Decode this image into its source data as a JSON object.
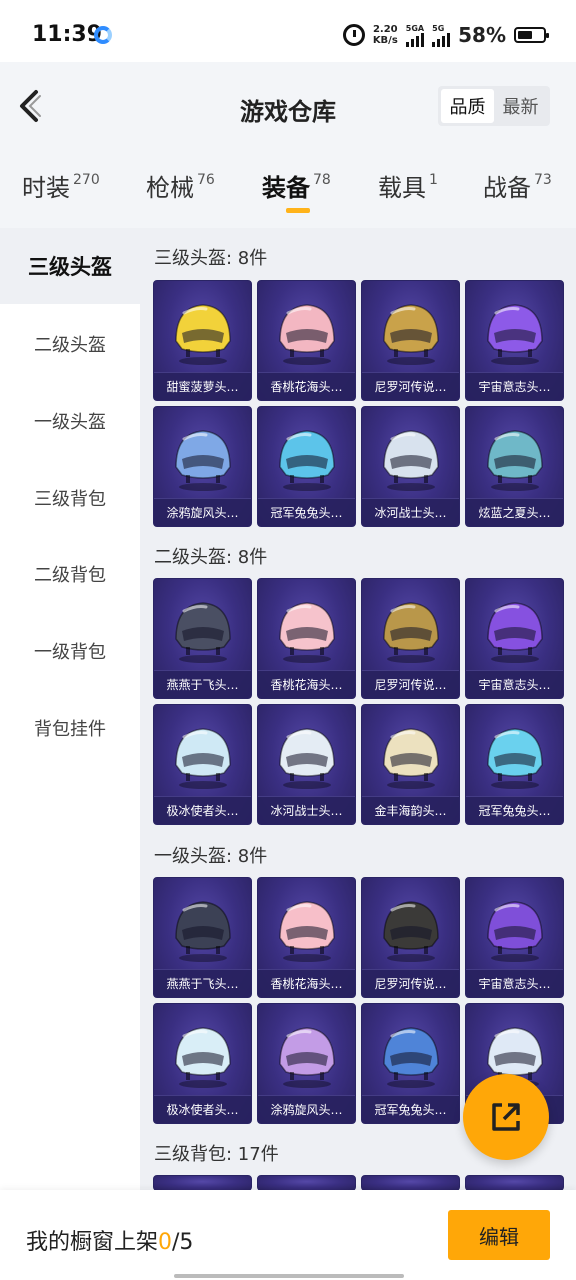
{
  "status": {
    "time": "11:39",
    "speed_top": "2.20",
    "speed_unit": "KB/s",
    "net1": "5GA",
    "net2": "5G",
    "battery_pct": "58%",
    "battery_level": 0.58
  },
  "header": {
    "title": "游戏仓库",
    "sort_options": [
      "品质",
      "最新"
    ],
    "sort_active": "品质"
  },
  "tabs": [
    {
      "label": "时装",
      "count": "270"
    },
    {
      "label": "枪械",
      "count": "76"
    },
    {
      "label": "装备",
      "count": "78"
    },
    {
      "label": "载具",
      "count": "1"
    },
    {
      "label": "战备",
      "count": "73"
    }
  ],
  "active_tab": "装备",
  "sidebar": {
    "items": [
      "三级头盔",
      "二级头盔",
      "一级头盔",
      "三级背包",
      "二级背包",
      "一级背包",
      "背包挂件"
    ],
    "active": "三级头盔"
  },
  "sections": [
    {
      "title": "三级头盔: 8件",
      "items": [
        {
          "name": "甜蜜菠萝头…",
          "icon": "pineapple-helmet-icon",
          "color": "#f2d23a"
        },
        {
          "name": "香桃花海头…",
          "icon": "pink-helmet-icon",
          "color": "#f3b7c2"
        },
        {
          "name": "尼罗河传说…",
          "icon": "egypt-helmet-icon",
          "color": "#c9a24a"
        },
        {
          "name": "宇宙意志头…",
          "icon": "cosmic-helmet-icon",
          "color": "#8d5ae8"
        },
        {
          "name": "涂鸦旋风头…",
          "icon": "graffiti-helmet-icon",
          "color": "#7fa8e6"
        },
        {
          "name": "冠军兔兔头…",
          "icon": "bunny-helmet-icon",
          "color": "#5cc4ea"
        },
        {
          "name": "冰河战士头…",
          "icon": "glacier-helmet-icon",
          "color": "#d8e2ee"
        },
        {
          "name": "炫蓝之夏头…",
          "icon": "summer-helmet-icon",
          "color": "#6fb8c8"
        }
      ]
    },
    {
      "title": "二级头盔: 8件",
      "items": [
        {
          "name": "燕燕于飞头…",
          "icon": "swallow-helmet-icon",
          "color": "#4a4f63"
        },
        {
          "name": "香桃花海头…",
          "icon": "pink-helmet-icon",
          "color": "#f6c3cc"
        },
        {
          "name": "尼罗河传说…",
          "icon": "egypt-helmet-icon",
          "color": "#b9974a"
        },
        {
          "name": "宇宙意志头…",
          "icon": "cosmic-helmet-icon",
          "color": "#8651e0"
        },
        {
          "name": "极冰使者头…",
          "icon": "ice-helmet-icon",
          "color": "#cfe9f5"
        },
        {
          "name": "冰河战士头…",
          "icon": "glacier-helmet-icon",
          "color": "#e4ecf4"
        },
        {
          "name": "金丰海韵头…",
          "icon": "golden-sea-helmet-icon",
          "color": "#ece1bf"
        },
        {
          "name": "冠军兔兔头…",
          "icon": "bunny-helmet-icon",
          "color": "#6ad1ee"
        }
      ]
    },
    {
      "title": "一级头盔: 8件",
      "items": [
        {
          "name": "燕燕于飞头…",
          "icon": "swallow-helmet-icon",
          "color": "#3c4155"
        },
        {
          "name": "香桃花海头…",
          "icon": "pink-helmet-icon",
          "color": "#f7bfc9"
        },
        {
          "name": "尼罗河传说…",
          "icon": "egypt-helmet-icon",
          "color": "#3b3a38"
        },
        {
          "name": "宇宙意志头…",
          "icon": "cosmic-helmet-icon",
          "color": "#7f4fd9"
        },
        {
          "name": "极冰使者头…",
          "icon": "ice-helmet-icon",
          "color": "#d9eef7"
        },
        {
          "name": "涂鸦旋风头…",
          "icon": "graffiti-helmet-icon",
          "color": "#c39ce6"
        },
        {
          "name": "冠军兔兔头…",
          "icon": "bunny-helmet-icon",
          "color": "#4f84d8"
        },
        {
          "name": "",
          "icon": "white-blue-helmet-icon",
          "color": "#dfe9f6"
        }
      ]
    },
    {
      "title": "三级背包: 17件",
      "items": []
    }
  ],
  "bottom": {
    "label": "我的橱窗上架",
    "count": "0",
    "total": "/5",
    "edit_label": "编辑"
  }
}
